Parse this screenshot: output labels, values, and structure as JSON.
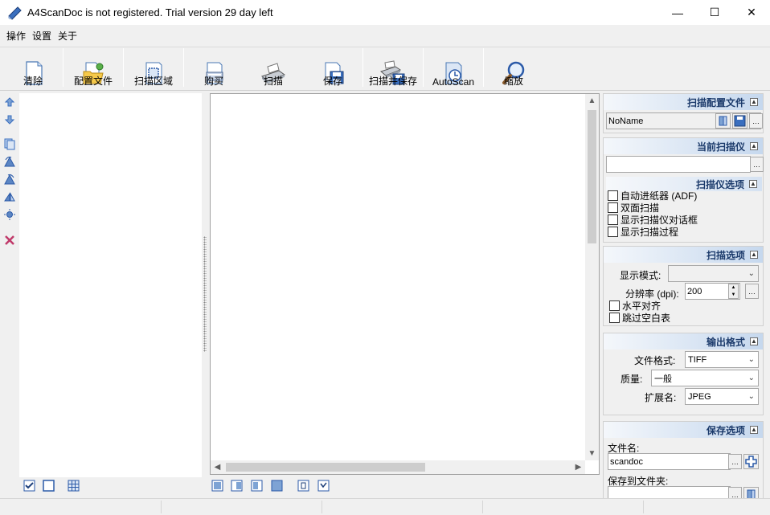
{
  "window": {
    "title": "A4ScanDoc is not registered. Trial version 29 day left",
    "minimize": "—",
    "maximize": "☐",
    "close": "✕"
  },
  "menu": [
    "操作",
    "设置",
    "关于"
  ],
  "toolbar": [
    {
      "label": "清除",
      "icon": "blank-page-icon"
    },
    {
      "label": "配置文件",
      "icon": "folder-profile-icon"
    },
    {
      "label": "扫描区域",
      "icon": "scan-area-icon"
    },
    {
      "label": "购买",
      "icon": "buy-icon"
    },
    {
      "label": "扫描",
      "icon": "scanner-icon"
    },
    {
      "label": "保存",
      "icon": "save-icon"
    },
    {
      "label": "扫描并保存",
      "icon": "scan-save-icon"
    },
    {
      "label": "AutoScan",
      "icon": "autoscan-icon"
    },
    {
      "label": "缩放",
      "icon": "magnifier-icon"
    }
  ],
  "right": {
    "profile": {
      "title": "扫描配置文件",
      "value": "NoName"
    },
    "scanner": {
      "title": "当前扫描仪",
      "value": ""
    },
    "scanner_options": {
      "title": "扫描仪选项",
      "items": [
        "自动进纸器 (ADF)",
        "双面扫描",
        "显示扫描仪对话框",
        "显示扫描过程"
      ]
    },
    "scan_options": {
      "title": "扫描选项",
      "mode_label": "显示模式:",
      "mode_value": "",
      "dpi_label": "分辨率 (dpi):",
      "dpi_value": "200",
      "items": [
        "水平对齐",
        "跳过空白表"
      ]
    },
    "output": {
      "title": "输出格式",
      "format_label": "文件格式:",
      "format_value": "TIFF",
      "quality_label": "质量:",
      "quality_value": "一般",
      "ext_label": "扩展名:",
      "ext_value": "JPEG"
    },
    "save": {
      "title": "保存选项",
      "filename_label": "文件名:",
      "filename_value": "scandoc",
      "folder_label": "保存到文件夹:",
      "folder_value": ""
    }
  }
}
